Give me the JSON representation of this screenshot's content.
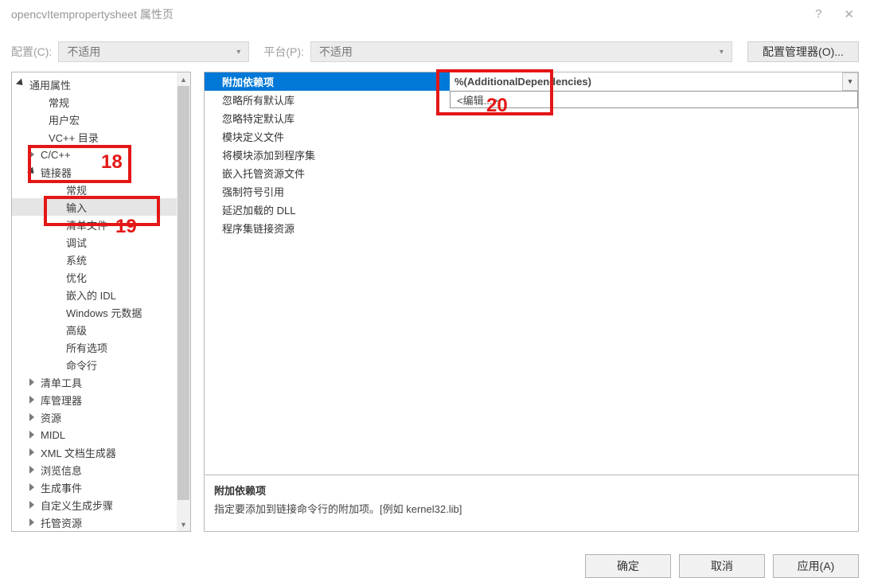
{
  "titlebar": {
    "title": "opencvItempropertysheet 属性页"
  },
  "toolbar": {
    "config_label": "配置(C):",
    "config_value": "不适用",
    "platform_label": "平台(P):",
    "platform_value": "不适用",
    "config_mgr": "配置管理器(O)..."
  },
  "tree": {
    "root": "通用属性",
    "items_top": [
      "常规",
      "用户宏",
      "VC++ 目录"
    ],
    "cpp": "C/C++",
    "linker": "链接器",
    "linker_children": [
      "常规",
      "输入",
      "清单文件",
      "调试",
      "系统",
      "优化",
      "嵌入的 IDL",
      "Windows 元数据",
      "高级",
      "所有选项",
      "命令行"
    ],
    "tail": [
      "清单工具",
      "库管理器",
      "资源",
      "MIDL",
      "XML 文档生成器",
      "浏览信息",
      "生成事件",
      "自定义生成步骤",
      "托管资源"
    ]
  },
  "grid": {
    "header_name": "附加依赖项",
    "header_value": "%(AdditionalDependencies)",
    "edit_text": "<编辑...>",
    "rows": [
      "忽略所有默认库",
      "忽略特定默认库",
      "模块定义文件",
      "将模块添加到程序集",
      "嵌入托管资源文件",
      "强制符号引用",
      "延迟加载的 DLL",
      "程序集链接资源"
    ]
  },
  "help": {
    "title": "附加依赖项",
    "body": "指定要添加到链接命令行的附加项。[例如 kernel32.lib]"
  },
  "footer": {
    "ok": "确定",
    "cancel": "取消",
    "apply": "应用(A)"
  },
  "annots": {
    "n18": "18",
    "n19": "19",
    "n20": "20"
  }
}
